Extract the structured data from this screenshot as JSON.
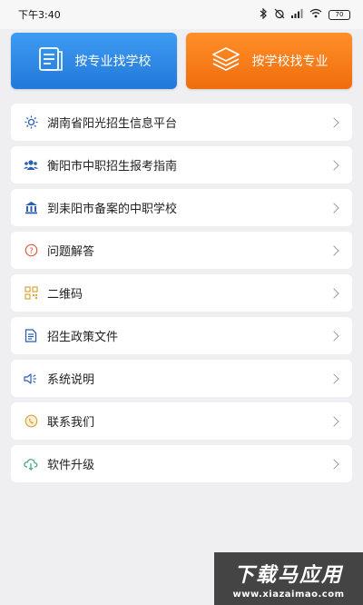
{
  "status_bar": {
    "time": "下午3:40",
    "battery": "70"
  },
  "top_buttons": {
    "by_major_label": "按专业找学校",
    "by_school_label": "按学校找专业"
  },
  "menu": {
    "items": [
      {
        "label": "湖南省阳光招生信息平台",
        "icon": "sun-icon"
      },
      {
        "label": "衡阳市中职招生报考指南",
        "icon": "people-icon"
      },
      {
        "label": "到耒阳市备案的中职学校",
        "icon": "building-icon"
      },
      {
        "label": "问题解答",
        "icon": "question-icon"
      },
      {
        "label": "二维码",
        "icon": "qr-code-icon"
      },
      {
        "label": "招生政策文件",
        "icon": "document-icon"
      },
      {
        "label": "系统说明",
        "icon": "speaker-icon"
      },
      {
        "label": "联系我们",
        "icon": "contact-icon"
      },
      {
        "label": "软件升级",
        "icon": "cloud-download-icon"
      }
    ]
  },
  "watermark": {
    "title": "下载马应用",
    "url": "www.xiazaimao.com"
  },
  "colors": {
    "blue_button": "#2f8ae6",
    "orange_button": "#f57a18",
    "background": "#efeff1"
  }
}
